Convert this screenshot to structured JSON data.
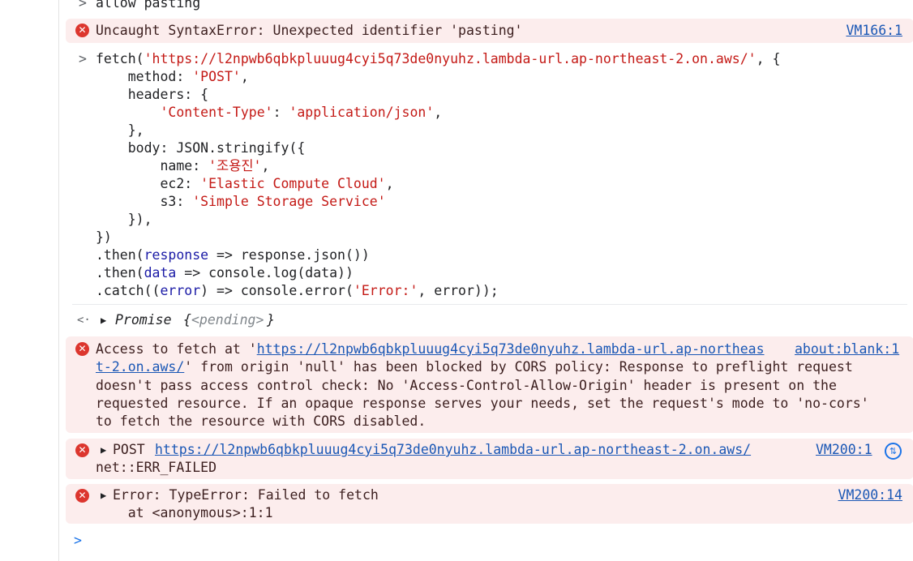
{
  "input1": {
    "caret": ">",
    "text": "allow pasting"
  },
  "error1": {
    "icon": "error-icon",
    "text": "Uncaught SyntaxError: Unexpected identifier 'pasting'",
    "source": "VM166:1"
  },
  "input2": {
    "caret": ">",
    "lines": [
      "fetch('https://l2npwb6qbkpluuug4cyi5q73de0nyuhz.lambda-url.ap-northeast-2.on.aws/', {",
      "    method: 'POST',",
      "    headers: {",
      "        'Content-Type': 'application/json',",
      "    },",
      "    body: JSON.stringify({",
      "        name: '조용진',",
      "        ec2: 'Elastic Compute Cloud',",
      "        s3: 'Simple Storage Service'",
      "    }),",
      "})",
      ".then(response => response.json())",
      ".then(data => console.log(data))",
      ".catch((error) => console.error('Error:', error));"
    ]
  },
  "result": {
    "caret": "<·",
    "label": "Promise",
    "open": "{",
    "state": "<pending>",
    "close": "}"
  },
  "error2": {
    "icon": "error-icon",
    "prefix": "Access to fetch at '",
    "url_part1": "https://l2npwb6qbkpluuug4cyi5q73de0nyuhz.lambda-url.ap-northeas",
    "url_part2": "t-2.on.aws/",
    "line2_rest": "' from origin 'null' has been blocked by CORS policy: Response to preflight request",
    "line3": "doesn't pass access control check: No 'Access-Control-Allow-Origin' header is present on the",
    "line4": "requested resource. If an opaque response serves your needs, set the request's mode to 'no-cors'",
    "line5": "to fetch the resource with CORS disabled.",
    "source_part1": "about:blank:1",
    "source_part2": "t-2.on.aws/"
  },
  "error3": {
    "icon": "error-icon",
    "method": "POST",
    "url": "https://l2npwb6qbkpluuug4cyi5q73de0nyuhz.lambda-url.ap-northeast-2.on.aws/",
    "line2": "net::ERR_FAILED",
    "source": "VM200:1"
  },
  "error4": {
    "icon": "error-icon",
    "text": "Error: TypeError: Failed to fetch",
    "line2": "    at <anonymous>:1:1",
    "source": "VM200:14"
  },
  "prompt": {
    "caret": ">"
  }
}
